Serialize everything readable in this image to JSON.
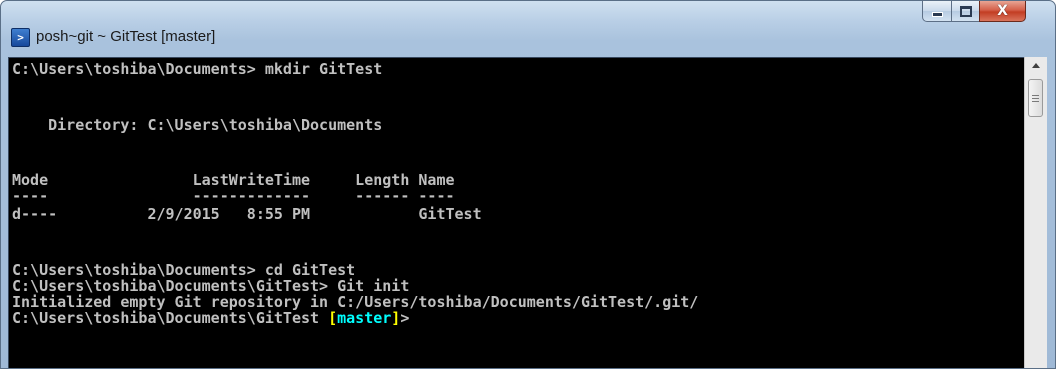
{
  "window": {
    "title": "posh~git ~ GitTest [master]",
    "app_icon": "powershell-icon",
    "controls": {
      "minimize_icon": "minimize-icon",
      "maximize_icon": "maximize-icon",
      "close_glyph": "X"
    }
  },
  "console": {
    "colors": {
      "background": "#000000",
      "text": "#c0c0c0",
      "bracket": "#ffff00",
      "branch": "#00ffff"
    },
    "lines": [
      "C:\\Users\\toshiba\\Documents> mkdir GitTest",
      "    Directory: C:\\Users\\toshiba\\Documents",
      "Mode                LastWriteTime     Length Name",
      "----                -------------     ------ ----",
      "d----          2/9/2015   8:55 PM            GitTest",
      "C:\\Users\\toshiba\\Documents> cd GitTest",
      "C:\\Users\\toshiba\\Documents\\GitTest> Git init",
      "Initialized empty Git repository in C:/Users/toshiba/Documents/GitTest/.git/"
    ],
    "prompt": {
      "path": "C:\\Users\\toshiba\\Documents\\GitTest ",
      "open_bracket": "[",
      "branch": "master",
      "close_bracket": "]",
      "suffix": ">"
    }
  },
  "scrollbar": {
    "up_icon": "scroll-up-arrow-icon"
  }
}
